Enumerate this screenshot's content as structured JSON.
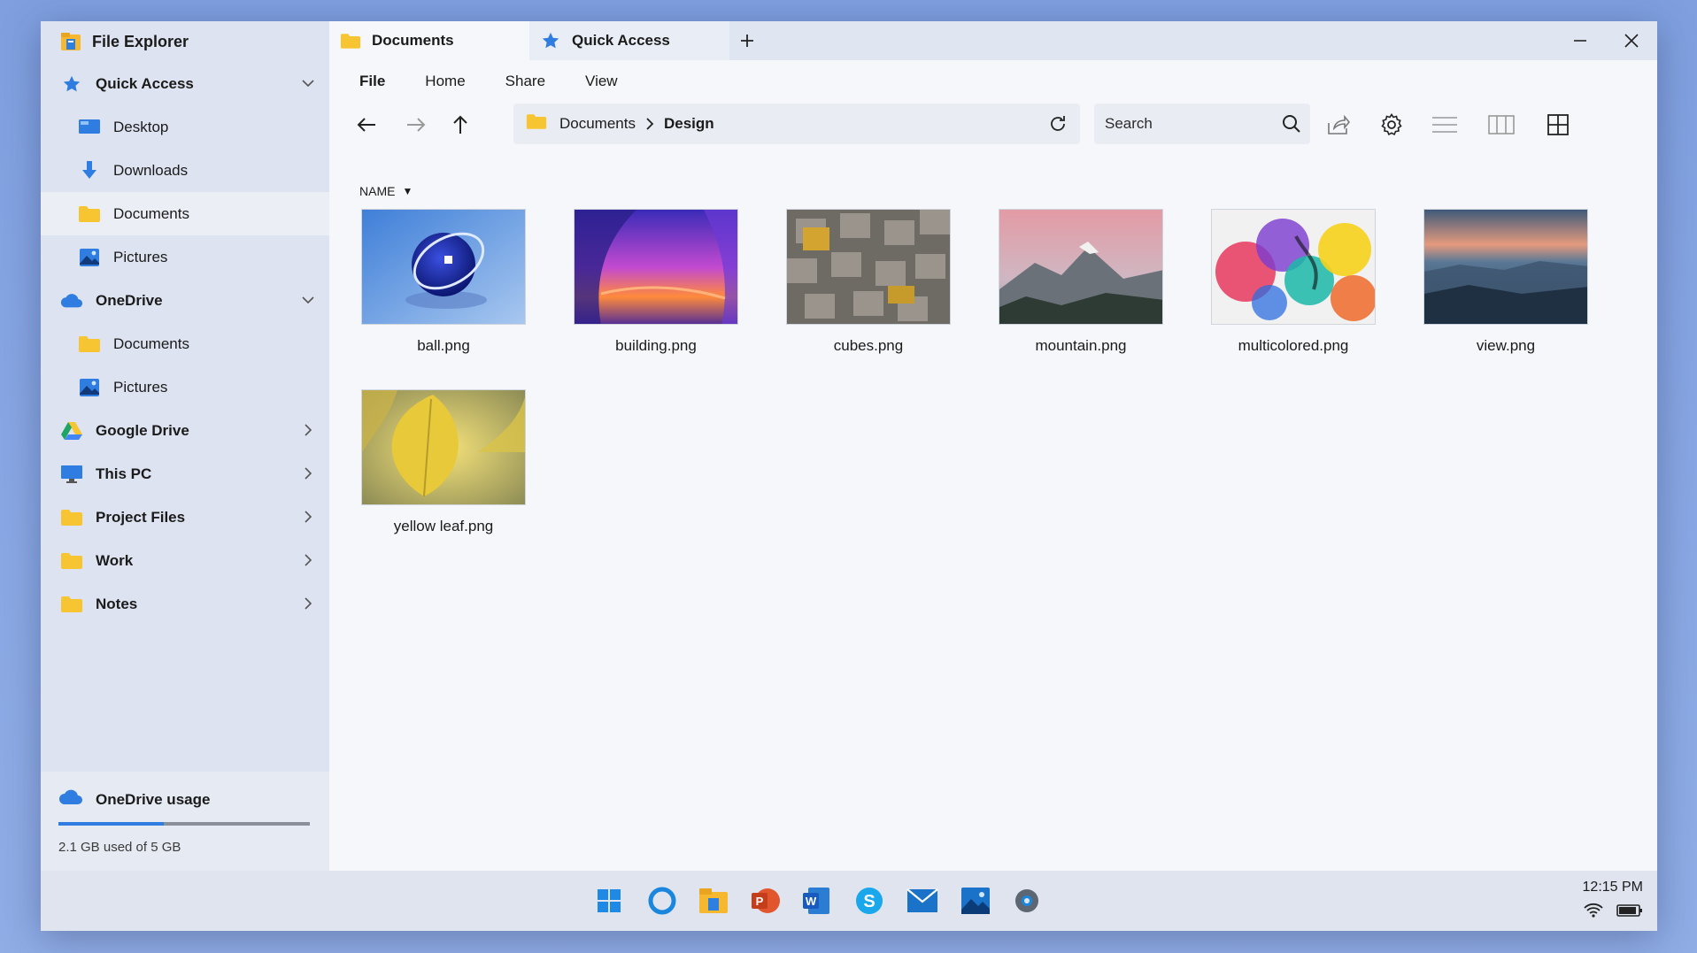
{
  "app": {
    "title": "File Explorer"
  },
  "sidebar": {
    "quick_access": "Quick Access",
    "quick_items": [
      {
        "label": "Desktop",
        "icon": "desktop-icon"
      },
      {
        "label": "Downloads",
        "icon": "download-arrow-icon"
      },
      {
        "label": "Documents",
        "icon": "folder-icon",
        "selected": true
      },
      {
        "label": "Pictures",
        "icon": "pictures-icon"
      }
    ],
    "onedrive": "OneDrive",
    "onedrive_items": [
      {
        "label": "Documents",
        "icon": "folder-icon"
      },
      {
        "label": "Pictures",
        "icon": "pictures-icon"
      }
    ],
    "roots": [
      {
        "label": "Google Drive",
        "icon": "google-drive-icon"
      },
      {
        "label": "This PC",
        "icon": "monitor-icon"
      },
      {
        "label": "Project Files",
        "icon": "folder-icon"
      },
      {
        "label": "Work",
        "icon": "folder-icon"
      },
      {
        "label": "Notes",
        "icon": "folder-icon"
      }
    ],
    "usage": {
      "label": "OneDrive usage",
      "text": "2.1 GB used of 5 GB",
      "fraction": 0.42
    }
  },
  "tabs": [
    {
      "label": "Documents",
      "icon": "folder-icon",
      "active": true
    },
    {
      "label": "Quick Access",
      "icon": "star-icon",
      "active": false
    }
  ],
  "menu": [
    "File",
    "Home",
    "Share",
    "View"
  ],
  "address": {
    "parent": "Documents",
    "current": "Design"
  },
  "search": {
    "placeholder": "Search"
  },
  "sort": {
    "label": "NAME",
    "arrow": "▼"
  },
  "files": [
    {
      "name": "ball.png"
    },
    {
      "name": "building.png"
    },
    {
      "name": "cubes.png"
    },
    {
      "name": "mountain.png"
    },
    {
      "name": "multicolored.png"
    },
    {
      "name": "view.png"
    },
    {
      "name": "yellow leaf.png"
    }
  ],
  "taskbar": {
    "apps": [
      "windows-start-icon",
      "cortana-icon",
      "file-explorer-icon",
      "powerpoint-icon",
      "word-icon",
      "skype-icon",
      "mail-icon",
      "photos-icon",
      "settings-icon"
    ],
    "time": "12:15 PM"
  },
  "colors": {
    "accent": "#2f7de1",
    "folder": "#f7c531"
  }
}
